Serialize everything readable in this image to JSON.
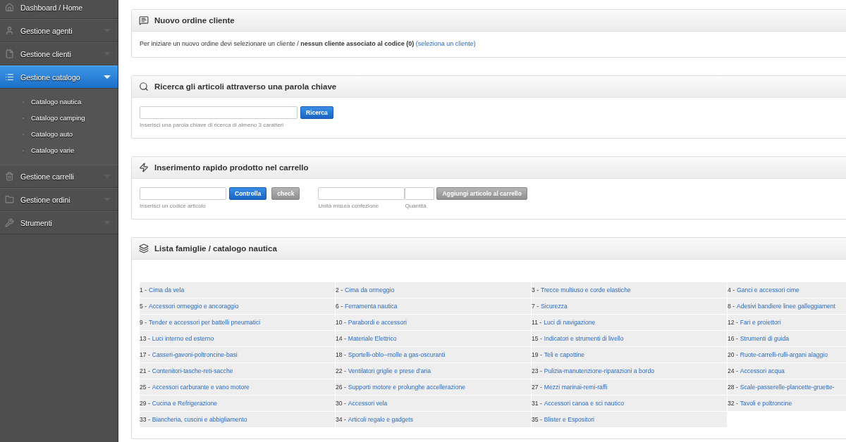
{
  "sidebar": {
    "items": [
      {
        "label": "Dashboard / Home",
        "selected": false,
        "expandable": false
      },
      {
        "label": "Gestione agenti",
        "selected": false,
        "expandable": true
      },
      {
        "label": "Gestione clienti",
        "selected": false,
        "expandable": true
      },
      {
        "label": "Gestione catalogo",
        "selected": true,
        "expandable": true,
        "children": [
          {
            "label": "Catalogo nautica"
          },
          {
            "label": "Catalogo camping"
          },
          {
            "label": "Catalogo auto"
          },
          {
            "label": "Catalogo varie"
          }
        ]
      },
      {
        "label": "Gestione carrelli",
        "selected": false,
        "expandable": true
      },
      {
        "label": "Gestione ordini",
        "selected": false,
        "expandable": true
      },
      {
        "label": "Strumenti",
        "selected": false,
        "expandable": true
      }
    ]
  },
  "new_order": {
    "title": "Nuovo ordine cliente",
    "text": "Per iniziare un nuovo ordine devi selezionare un cliente / **nessun cliente associato al codice (0)**",
    "link": "(seleziona un cliente)"
  },
  "search": {
    "title": "Ricerca gli articoli attraverso una parola chiave",
    "button": "Ricerca",
    "help": "Inserisci una parola chiave di ricerca di almeno 3 caratteri"
  },
  "quick_add": {
    "title": "Inserimento rapido prodotto nel carrello",
    "code_help": "Inserisci un codice articolo",
    "check_button": "Controlla",
    "check2_button": "check",
    "unit_help": "Unità misura confezione",
    "qty_help": "Quantità",
    "add_button": "Aggiungi articolo al carrello"
  },
  "families": {
    "title": "Lista famiglie / catalogo nautica",
    "items": [
      {
        "prefix": "1 -",
        "name": "Cima da vela"
      },
      {
        "prefix": "2 -",
        "name": "Cima da ormeggio"
      },
      {
        "prefix": "3 -",
        "name": "Trecce multiuso e corde elastiche"
      },
      {
        "prefix": "4 -",
        "name": "Ganci e accessori cime"
      },
      {
        "prefix": "5 -",
        "name": "Accessori ormeggio e ancoraggio"
      },
      {
        "prefix": "6 -",
        "name": "Ferramenta nautica"
      },
      {
        "prefix": "7 -",
        "name": "Sicurezza"
      },
      {
        "prefix": "8 -",
        "name": "Adesivi bandiere linee galleggiament"
      },
      {
        "prefix": "9 -",
        "name": "Tender e accessori per battelli pneumatici"
      },
      {
        "prefix": "10 -",
        "name": "Parabordi e accessori"
      },
      {
        "prefix": "11 -",
        "name": "Luci di navigazione"
      },
      {
        "prefix": "12 -",
        "name": "Fari e proiettori"
      },
      {
        "prefix": "13 -",
        "name": "Luci interno ed esterno"
      },
      {
        "prefix": "14 -",
        "name": "Materiale Elettrico"
      },
      {
        "prefix": "15 -",
        "name": "Indicatori e strumenti di livello"
      },
      {
        "prefix": "16 -",
        "name": "Strumenti di guida"
      },
      {
        "prefix": "17 -",
        "name": "Casseri-gavoni-poltroncine-basi"
      },
      {
        "prefix": "18 -",
        "name": "Sportelli-oblo--molle a gas-oscuranti"
      },
      {
        "prefix": "19 -",
        "name": "Teli e capottine"
      },
      {
        "prefix": "20 -",
        "name": "Ruote-carrelli-rulli-argani alaggio"
      },
      {
        "prefix": "21 -",
        "name": "Contenitori-tasche-reti-sacche"
      },
      {
        "prefix": "22 -",
        "name": "Ventilatori griglie e prese d'aria"
      },
      {
        "prefix": "23 -",
        "name": "Pulizia-manutenzione-riparazioni a bordo"
      },
      {
        "prefix": "24 -",
        "name": "Accessori acqua"
      },
      {
        "prefix": "25 -",
        "name": "Accessori carburante e vano motore"
      },
      {
        "prefix": "26 -",
        "name": "Supporti motore e prolunghe accellerazione"
      },
      {
        "prefix": "27 -",
        "name": "Mezzi marinai-remi-raffi"
      },
      {
        "prefix": "28 -",
        "name": "Scale-passerelle-plancette-gruette-"
      },
      {
        "prefix": "29 -",
        "name": "Cucina e Refrigerazione"
      },
      {
        "prefix": "30 -",
        "name": "Accessori vela"
      },
      {
        "prefix": "31 -",
        "name": "Accessori canoa e sci nautico"
      },
      {
        "prefix": "32 -",
        "name": "Tavoli e poltroncine"
      },
      {
        "prefix": "33 -",
        "name": "Biancheria, cuscini e abbigliamento"
      },
      {
        "prefix": "34 -",
        "name": "Articoli regalo e gadgets"
      },
      {
        "prefix": "35 -",
        "name": "Blister e Espositori"
      }
    ]
  }
}
